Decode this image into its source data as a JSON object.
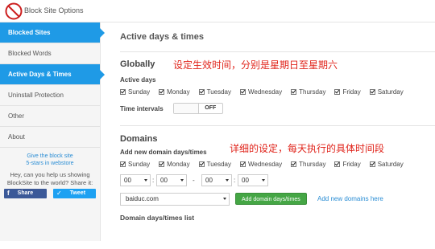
{
  "header": {
    "title": "Block Site Options",
    "logo_text": "WWW"
  },
  "sidebar": {
    "items": [
      {
        "label": "Blocked Sites",
        "active": true
      },
      {
        "label": "Blocked Words",
        "active": false
      },
      {
        "label": "Active Days & Times",
        "active": true
      },
      {
        "label": "Uninstall Protection",
        "active": false
      },
      {
        "label": "Other",
        "active": false
      },
      {
        "label": "About",
        "active": false
      }
    ],
    "promo_line1": "Give the block site",
    "promo_line2": "5-stars in webstore",
    "share_text": "Hey, can you help us showing BlockSite to the world? Share it:",
    "facebook_label": "Share",
    "twitter_label": "Tweet"
  },
  "main": {
    "page_title": "Active days & times",
    "globally": {
      "title": "Globally",
      "active_days_label": "Active days",
      "days": [
        "Sunday",
        "Monday",
        "Tuesday",
        "Wednesday",
        "Thursday",
        "Friday",
        "Saturday"
      ],
      "time_intervals_label": "Time intervals",
      "toggle_state": "OFF"
    },
    "domains": {
      "title": "Domains",
      "add_label": "Add new domain days/times",
      "days": [
        "Sunday",
        "Monday",
        "Tuesday",
        "Wednesday",
        "Thursday",
        "Friday",
        "Saturday"
      ],
      "time_start_hour": "00",
      "time_start_min": "00",
      "time_dash": "-",
      "time_end_hour": "00",
      "time_end_min": "00",
      "domain_value": "baiduc.com",
      "add_button": "Add domain days/times",
      "add_link": "Add new domains here",
      "list_title": "Domain days/times list"
    }
  },
  "annotations": {
    "globally_note": "设定生效时间，分别是星期日至星期六",
    "domains_note": "详细的设定，每天执行的具体时间段"
  },
  "colors": {
    "accent": "#1f9ae6",
    "add_button": "#45a645",
    "link": "#2a8dd4",
    "annotation": "#e0241b"
  }
}
